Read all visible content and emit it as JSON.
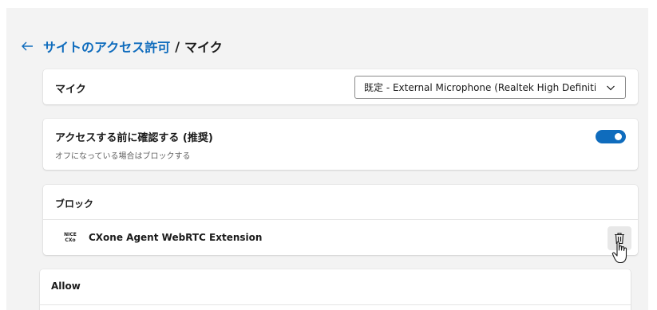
{
  "header": {
    "back_icon": "back-arrow-icon",
    "breadcrumb_link": "サイトのアクセス許可",
    "breadcrumb_separator": "/",
    "breadcrumb_current": "マイク"
  },
  "mic_setting": {
    "label": "マイク",
    "selected_device": "既定 - External Microphone (Realtek High Definiti...",
    "chevron_icon": "chevron-down-icon"
  },
  "ask_setting": {
    "title": "アクセスする前に確認する (推奨)",
    "subtitle": "オフになっている場合はブロックする",
    "toggle_on": true,
    "accent_color": "#0f6cbd"
  },
  "block_section": {
    "title": "ブロック",
    "items": [
      {
        "icon_line1": "NICE",
        "icon_line2": "CXo",
        "name": "CXone Agent WebRTC Extension",
        "action_icon": "trash-icon"
      }
    ]
  },
  "allow_section": {
    "title": "Allow"
  }
}
